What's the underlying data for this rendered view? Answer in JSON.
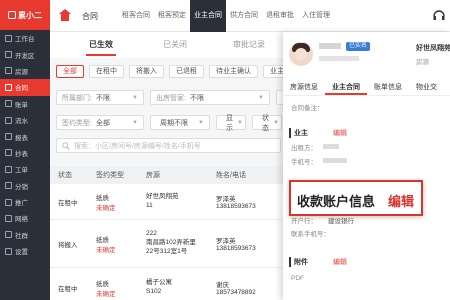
{
  "app": {
    "logo": "累小二"
  },
  "sidebar": {
    "items": [
      {
        "label": "工作台"
      },
      {
        "label": "开发区"
      },
      {
        "label": "房源"
      },
      {
        "label": "合同",
        "active": true
      },
      {
        "label": "账单"
      },
      {
        "label": "流水"
      },
      {
        "label": "报表"
      },
      {
        "label": "抄表"
      },
      {
        "label": "工单"
      },
      {
        "label": "分销"
      },
      {
        "label": "推广"
      },
      {
        "label": "网络"
      },
      {
        "label": "社群"
      },
      {
        "label": "设置"
      }
    ]
  },
  "topbar": {
    "module": "合同",
    "tabs": [
      {
        "label": "租客合同"
      },
      {
        "label": "租客预定"
      },
      {
        "label": "业主合同",
        "active": true
      },
      {
        "label": "供方合同"
      },
      {
        "label": "退租审批"
      },
      {
        "label": "入住管理"
      }
    ]
  },
  "status_tabs": [
    {
      "label": "已生效",
      "active": true
    },
    {
      "label": "已关闭"
    },
    {
      "label": "审批记录"
    }
  ],
  "filter_chips": [
    {
      "label": "全部",
      "active": true
    },
    {
      "label": "在租中"
    },
    {
      "label": "将搬入"
    },
    {
      "label": "已退租"
    },
    {
      "label": "待业主确认"
    },
    {
      "label": "业主"
    }
  ],
  "selects_row1": [
    {
      "label": "所属部门:",
      "value": "不限"
    },
    {
      "label": "出房管家:",
      "value": "不限"
    },
    {
      "label": "",
      "value": ""
    }
  ],
  "selects_row2": [
    {
      "label": "签约类型:",
      "value": "全部"
    },
    {
      "label": "",
      "value": "周期不限"
    },
    {
      "label": "",
      "value": "显示"
    },
    {
      "label": "",
      "value": "状态"
    }
  ],
  "search": {
    "placeholder": "搜索：小区/房间号/房源编号/姓名/手机号"
  },
  "table": {
    "headers": [
      "状态",
      "签约类型",
      "房源",
      "姓名/电话"
    ],
    "rows": [
      {
        "status": "在租中",
        "type": "纸质",
        "sign": "未确定",
        "house": "好世凤翔苑\n11",
        "name": "罗泽英",
        "phone": "13818593673"
      },
      {
        "status": "将搬入",
        "type": "纸质",
        "sign": "未确定",
        "house": "222\n南昌路102弄新里\n22号312室1号",
        "name": "罗泽英",
        "phone": "13818593673"
      },
      {
        "status": "在租中",
        "type": "纸质",
        "sign": "未确定",
        "house": "橘子公寓\nS102",
        "name": "谢庆",
        "phone": "18573478892"
      }
    ]
  },
  "panel": {
    "verified": "已实名",
    "apartment": "好世凤翔苑",
    "apartment_sub": "房源",
    "tabs": [
      {
        "label": "房源信息"
      },
      {
        "label": "业主合同",
        "active": true
      },
      {
        "label": "账单信息"
      },
      {
        "label": "物业交"
      }
    ],
    "note_label": "合同备注：",
    "owner_section": "业主",
    "edit_label": "编辑",
    "owner_fields": [
      "出租方：",
      "手机号："
    ],
    "account_section": "收款账户信息",
    "account_edit": "编辑",
    "bank_fields": [
      "开户行：",
      "建设银行",
      "联系手机号："
    ],
    "attach_section": "附件",
    "pdf": "PDF"
  }
}
